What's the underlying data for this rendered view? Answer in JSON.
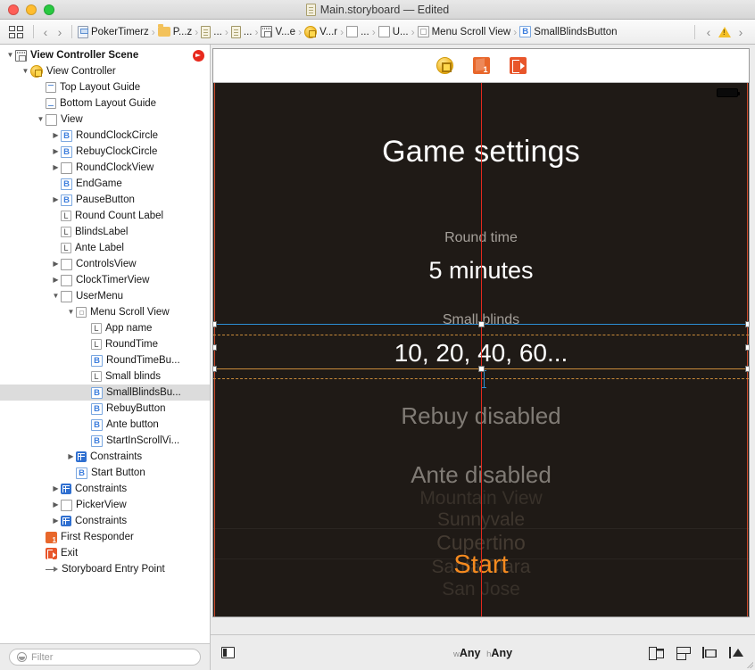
{
  "window": {
    "title": "Main.storyboard — Edited",
    "title_icon": "storyboard-document-icon",
    "traffic_lights": [
      "close",
      "minimize",
      "zoom"
    ]
  },
  "jumpbar": {
    "grid_icon": "related-items-icon",
    "back_arrow": "‹",
    "forward_arrow": "›",
    "separator": "›",
    "crumbs": [
      {
        "label": "PokerTimerz",
        "icon": "project-icon"
      },
      {
        "label": "P...z",
        "icon": "folder-icon"
      },
      {
        "label": "...",
        "icon": "file-icon"
      },
      {
        "label": "...",
        "icon": "file-icon"
      },
      {
        "label": "V...e",
        "icon": "view-controller-scene-icon"
      },
      {
        "label": "V...r",
        "icon": "view-controller-icon"
      },
      {
        "label": "...",
        "icon": "view-icon"
      },
      {
        "label": "U...",
        "icon": "view-icon"
      },
      {
        "label": "Menu Scroll View",
        "icon": "scroll-view-icon"
      },
      {
        "label": "SmallBlindsButton",
        "icon": "button-icon"
      }
    ],
    "issue_icon": "warning-triangle-icon",
    "prev_issue": "‹",
    "next_issue": "›"
  },
  "outline": {
    "rows": [
      {
        "label": "View Controller Scene",
        "indent": 0,
        "twisty": "open",
        "icon": "scene-icon",
        "bold": true,
        "trailing": "storyboard-entry-point-dot"
      },
      {
        "label": "View Controller",
        "indent": 1,
        "twisty": "open",
        "icon": "view-controller-icon",
        "bold": false
      },
      {
        "label": "Top Layout Guide",
        "indent": 2,
        "twisty": "none",
        "icon": "top-layout-guide-icon",
        "bold": false
      },
      {
        "label": "Bottom Layout Guide",
        "indent": 2,
        "twisty": "none",
        "icon": "bottom-layout-guide-icon",
        "bold": false
      },
      {
        "label": "View",
        "indent": 2,
        "twisty": "open",
        "icon": "view-icon",
        "bold": false
      },
      {
        "label": "RoundClockCircle",
        "indent": 3,
        "twisty": "closed",
        "icon": "button-icon",
        "bold": false
      },
      {
        "label": "RebuyClockCircle",
        "indent": 3,
        "twisty": "closed",
        "icon": "button-icon",
        "bold": false
      },
      {
        "label": "RoundClockView",
        "indent": 3,
        "twisty": "closed",
        "icon": "view-icon",
        "bold": false
      },
      {
        "label": "EndGame",
        "indent": 3,
        "twisty": "none",
        "icon": "button-icon",
        "bold": false
      },
      {
        "label": "PauseButton",
        "indent": 3,
        "twisty": "closed",
        "icon": "button-icon",
        "bold": false
      },
      {
        "label": "Round Count Label",
        "indent": 3,
        "twisty": "none",
        "icon": "label-icon",
        "bold": false
      },
      {
        "label": "BlindsLabel",
        "indent": 3,
        "twisty": "none",
        "icon": "label-icon",
        "bold": false
      },
      {
        "label": "Ante Label",
        "indent": 3,
        "twisty": "none",
        "icon": "label-icon",
        "bold": false
      },
      {
        "label": "ControlsView",
        "indent": 3,
        "twisty": "closed",
        "icon": "view-icon",
        "bold": false
      },
      {
        "label": "ClockTimerView",
        "indent": 3,
        "twisty": "closed",
        "icon": "view-icon",
        "bold": false
      },
      {
        "label": "UserMenu",
        "indent": 3,
        "twisty": "open",
        "icon": "view-icon",
        "bold": false
      },
      {
        "label": "Menu Scroll View",
        "indent": 4,
        "twisty": "open",
        "icon": "scroll-view-icon",
        "bold": false
      },
      {
        "label": "App name",
        "indent": 5,
        "twisty": "none",
        "icon": "label-icon",
        "bold": false
      },
      {
        "label": "RoundTime",
        "indent": 5,
        "twisty": "none",
        "icon": "label-icon",
        "bold": false
      },
      {
        "label": "RoundTimeBu...",
        "indent": 5,
        "twisty": "none",
        "icon": "button-icon",
        "bold": false
      },
      {
        "label": "Small blinds",
        "indent": 5,
        "twisty": "none",
        "icon": "label-icon",
        "bold": false
      },
      {
        "label": "SmallBlindsBu...",
        "indent": 5,
        "twisty": "none",
        "icon": "button-icon",
        "bold": false,
        "selected": true
      },
      {
        "label": "RebuyButton",
        "indent": 5,
        "twisty": "none",
        "icon": "button-icon",
        "bold": false
      },
      {
        "label": "Ante button",
        "indent": 5,
        "twisty": "none",
        "icon": "button-icon",
        "bold": false
      },
      {
        "label": "StartInScrollVi...",
        "indent": 5,
        "twisty": "none",
        "icon": "button-icon",
        "bold": false
      },
      {
        "label": "Constraints",
        "indent": 4,
        "twisty": "closed",
        "icon": "constraints-icon",
        "bold": false
      },
      {
        "label": "Start Button",
        "indent": 4,
        "twisty": "none",
        "icon": "button-icon",
        "bold": false
      },
      {
        "label": "Constraints",
        "indent": 3,
        "twisty": "closed",
        "icon": "constraints-icon",
        "bold": false
      },
      {
        "label": "PickerView",
        "indent": 3,
        "twisty": "closed",
        "icon": "view-icon",
        "bold": false
      },
      {
        "label": "Constraints",
        "indent": 3,
        "twisty": "closed",
        "icon": "constraints-icon",
        "bold": false
      },
      {
        "label": "First Responder",
        "indent": 2,
        "twisty": "none",
        "icon": "first-responder-icon",
        "bold": false
      },
      {
        "label": "Exit",
        "indent": 2,
        "twisty": "none",
        "icon": "exit-icon",
        "bold": false
      },
      {
        "label": "Storyboard Entry Point",
        "indent": 2,
        "twisty": "none",
        "icon": "entry-point-arrow-icon",
        "bold": false
      }
    ],
    "filter": {
      "placeholder": "Filter",
      "value": "",
      "icon": "filter-icon"
    }
  },
  "canvas": {
    "dock_icons": [
      "view-controller-icon",
      "first-responder-icon",
      "exit-icon"
    ],
    "screen": {
      "status_battery_icon": "battery-icon",
      "title": "Game settings",
      "round_time_label": "Round time",
      "round_time_value": "5 minutes",
      "small_blinds_label": "Small blinds",
      "small_blinds_value": "10, 20, 40, 60...",
      "rebuy_value": "Rebuy disabled",
      "ante_value": "Ante disabled",
      "start_label": "Start",
      "picker_rows": [
        "Mountain View",
        "Sunnyvale",
        "Cupertino",
        "Santa Clara",
        "San Jose"
      ]
    },
    "colors": {
      "screen_background": "#1f1a16",
      "accent_orange": "#f58a1f",
      "guide_red": "#e4291d",
      "selection_blue": "#2c8fd6",
      "constraint_orange": "#c98a3a",
      "dim_text": "#807b75"
    }
  },
  "canvas_bar": {
    "panel_toggle_icon": "document-outline-toggle-icon",
    "size_class": {
      "width_prefix": "w",
      "width_value": "Any",
      "height_prefix": "h",
      "height_value": "Any"
    },
    "buttons": [
      {
        "name": "align-button",
        "icon": "align-icon"
      },
      {
        "name": "pin-button",
        "icon": "pin-icon"
      },
      {
        "name": "resolve-auto-layout-issues-button",
        "icon": "resolve-icon"
      },
      {
        "name": "embed-in-stack-button",
        "icon": "stack-icon"
      }
    ]
  }
}
